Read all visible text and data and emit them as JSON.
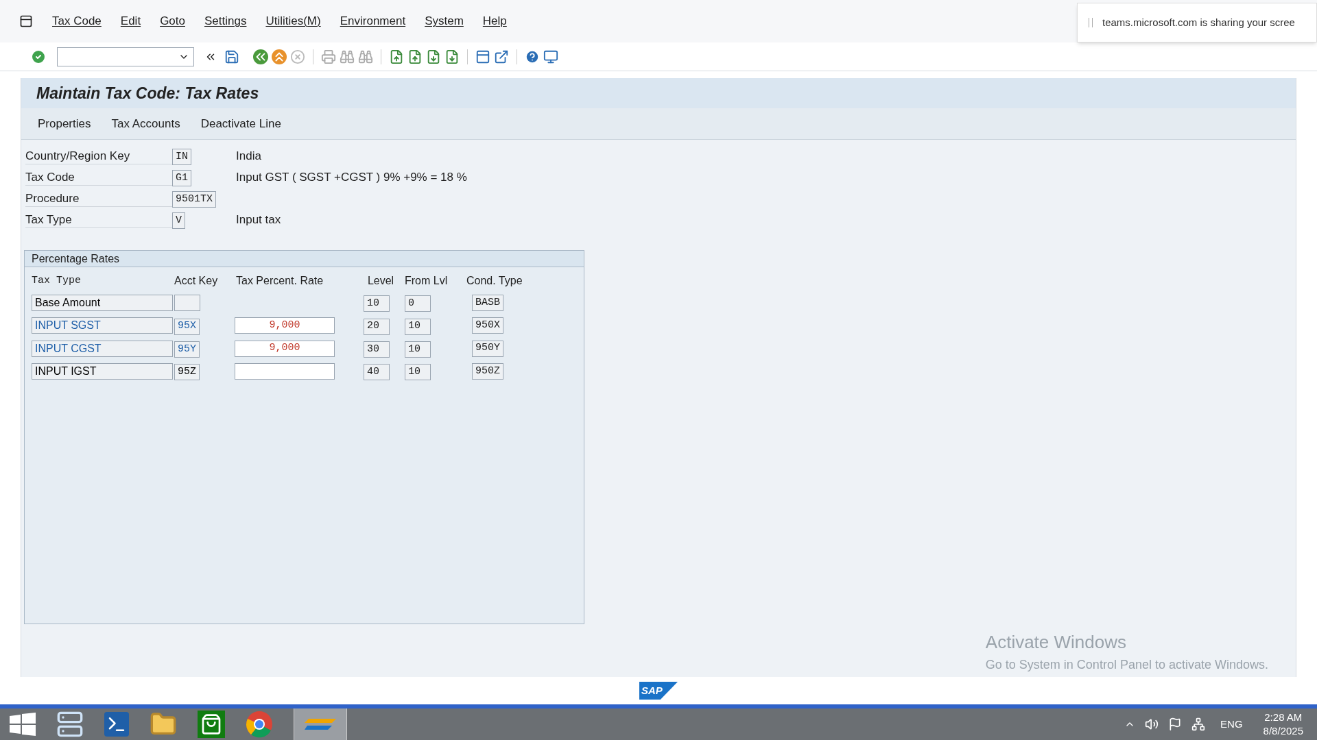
{
  "menu_bar": {
    "items": [
      "Tax Code",
      "Edit",
      "Goto",
      "Settings",
      "Utilities(M)",
      "Environment",
      "System",
      "Help"
    ]
  },
  "notification": {
    "text": "teams.microsoft.com is sharing your scree"
  },
  "screen": {
    "title": "Maintain Tax Code: Tax Rates",
    "actions": [
      "Properties",
      "Tax Accounts",
      "Deactivate Line"
    ]
  },
  "fields": [
    {
      "label": "Country/Region Key",
      "value": "IN",
      "description": "India"
    },
    {
      "label": "Tax Code",
      "value": "G1",
      "description": "Input GST ( SGST +CGST ) 9% +9% = 18 %"
    },
    {
      "label": "Procedure",
      "value": "9501TX"
    },
    {
      "label": "Tax Type",
      "value": "V",
      "description": "Input tax"
    }
  ],
  "percentage_rates": {
    "title": "Percentage Rates",
    "columns": [
      "Tax Type",
      "Acct Key",
      "Tax Percent. Rate",
      "Level",
      "From Lvl",
      "Cond. Type"
    ],
    "rows": [
      {
        "kind": "base",
        "tax_type": "Base Amount",
        "color": "#000000",
        "level": "10",
        "from_lvl": "0",
        "cond_type": "BASB"
      },
      {
        "kind": "tax",
        "tax_type": "INPUT SGST",
        "color": "#1f5fa8",
        "acct_key": "95X",
        "rate": "9,000",
        "level": "20",
        "from_lvl": "10",
        "cond_type": "950X"
      },
      {
        "kind": "tax",
        "tax_type": "INPUT CGST",
        "color": "#1f5fa8",
        "acct_key": "95Y",
        "rate": "9,000",
        "level": "30",
        "from_lvl": "10",
        "cond_type": "950Y"
      },
      {
        "kind": "tax",
        "tax_type": "INPUT IGST",
        "color": "#000000",
        "acct_key": "95Z",
        "level": "40",
        "from_lvl": "10",
        "cond_type": "950Z"
      }
    ]
  },
  "windows_watermark": {
    "title": "Activate Windows",
    "text": "Go to System in Control Panel to activate Windows."
  },
  "footer": {
    "logo_text": "SAP"
  },
  "taskbar": {
    "language": "ENG",
    "time": "2:28 AM",
    "date": "8/8/2025"
  }
}
